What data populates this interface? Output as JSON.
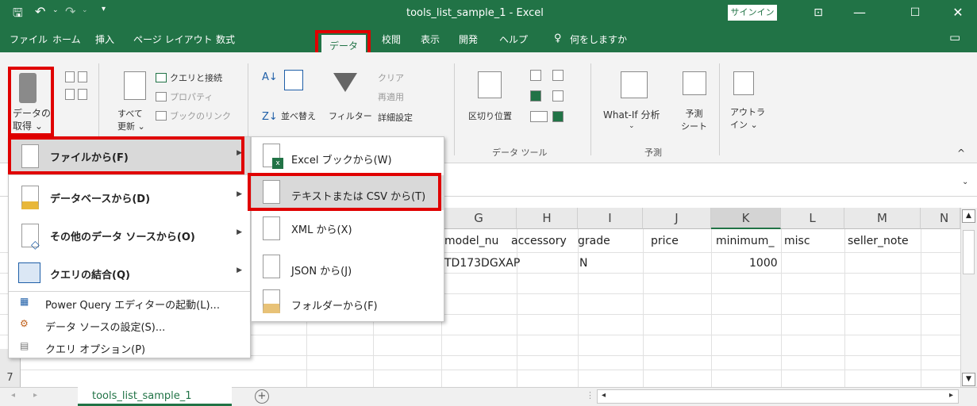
{
  "window": {
    "quick_save": "🖫",
    "undo": "↶",
    "redo": "↷",
    "title": "tools_list_sample_1  -  Excel",
    "signin": "サインイン",
    "ribbon_display": "⊡",
    "minimize": "—",
    "maximize": "☐",
    "close": "✕"
  },
  "tabs": [
    "ファイル",
    "ホーム",
    "挿入",
    "ページ レイアウト",
    "数式",
    "データ",
    "校閲",
    "表示",
    "開発",
    "ヘルプ"
  ],
  "tell_me": "何をしますか",
  "ribbon": {
    "get_data": "データの\n取得 ⌄",
    "refresh_all": "すべて\n更新 ⌄",
    "queries_connections": "クエリと接続",
    "properties": "プロパティ",
    "edit_links": "ブックのリンク",
    "sort": "並べ替え",
    "filter": "フィルター",
    "clear": "クリア",
    "reapply": "再適用",
    "advanced": "詳細設定",
    "text_to_columns": "区切り位置",
    "group_data_tools": "データ ツール",
    "whatif": "What-If 分析",
    "whatif_arrow": "⌄",
    "forecast_sheet": "予測\nシート",
    "group_forecast": "予測",
    "outline": "アウトラ\nイン ⌄"
  },
  "columns": [
    "G",
    "H",
    "I",
    "J",
    "K",
    "L",
    "M",
    "N"
  ],
  "header_row": [
    "model_nu",
    "accessory",
    "grade",
    "",
    "price",
    "minimum_",
    "misc",
    "",
    "seller_note"
  ],
  "data_row": {
    "model": "TD173DGXAP",
    "grade": "N",
    "minimum": "1000"
  },
  "rows": [
    "7"
  ],
  "menu_get_data": [
    {
      "label": "ファイルから(F)",
      "icon": "file-icon"
    },
    {
      "label": "データベースから(D)",
      "icon": "database-icon"
    },
    {
      "label": "その他のデータ ソースから(O)",
      "icon": "other-sources-icon"
    },
    {
      "label": "クエリの結合(Q)",
      "icon": "combine-queries-icon"
    }
  ],
  "menu_get_data_simple": [
    "Power Query エディターの起動(L)...",
    "データ ソースの設定(S)...",
    "クエリ オプション(P)"
  ],
  "menu_from_file": [
    "Excel ブックから(W)",
    "テキストまたは CSV から(T)",
    "XML から(X)",
    "JSON から(J)",
    "フォルダーから(F)"
  ],
  "sheet_tab": "tools_list_sample_1",
  "add_sheet": "+",
  "highlight_color": "#e00000",
  "accent_color": "#217346"
}
